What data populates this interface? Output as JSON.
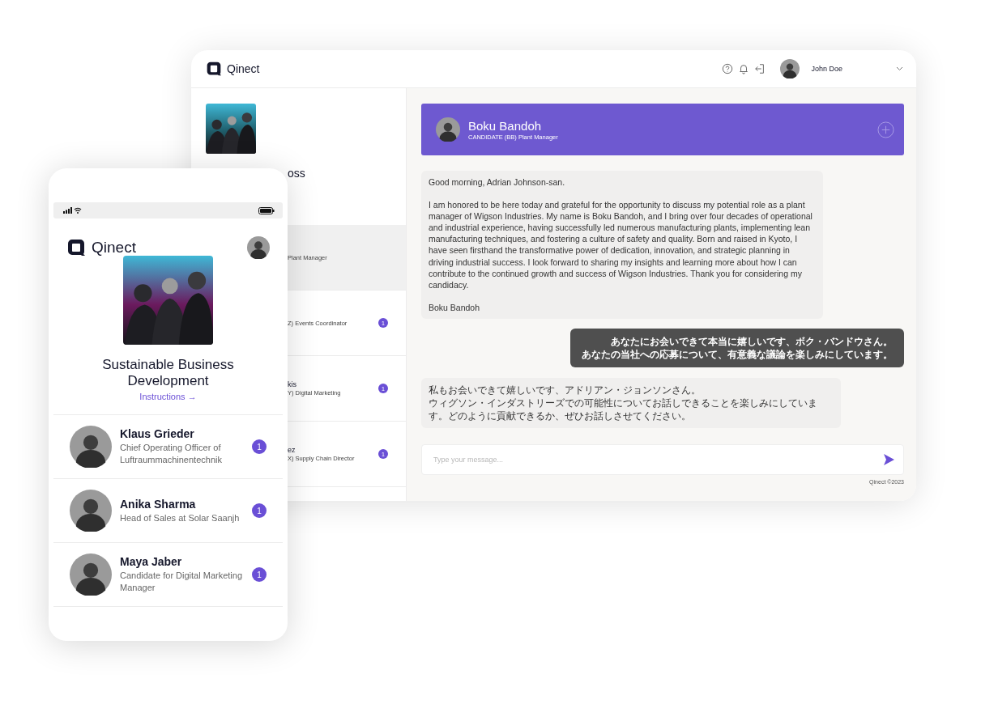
{
  "desktop": {
    "brand": "Qinect",
    "user": {
      "name": "John Doe"
    },
    "sidebar": {
      "course_title": "oss",
      "items": [
        {
          "role": "Plant Manager",
          "selected": true
        },
        {
          "role": "Z) Events Coordinator",
          "badge": "1",
          "selected": false
        },
        {
          "name": "kis",
          "role": "Y) Digital Marketing",
          "badge": "1",
          "selected": false
        },
        {
          "name": "ez",
          "role": "X) Supply Chain Director",
          "badge": "1",
          "selected": false
        }
      ]
    },
    "chat": {
      "header": {
        "name": "Boku Bandoh",
        "subtitle": "CANDIDATE (BB) Plant Manager"
      },
      "messages": [
        {
          "kind": "received",
          "lines": [
            "Good morning, Adrian Johnson-san.",
            "I am honored to be here today and grateful for the opportunity to discuss my potential role as a plant manager of Wigson Industries. My name is Boku Bandoh, and I bring over four decades of operational and industrial experience, having successfully led numerous manufacturing plants, implementing lean manufacturing techniques, and fostering a culture of safety and quality. Born and raised in Kyoto, I have seen firsthand the transformative power of dedication, innovation, and strategic planning in driving industrial success. I look forward to sharing my insights and learning more about how I can contribute to the continued growth and success of Wigson Industries. Thank you for considering my candidacy.",
            "Boku Bandoh"
          ]
        },
        {
          "kind": "sent",
          "lines": [
            "あなたにお会いできて本当に嬉しいです、ボク・バンドウさん。",
            "あなたの当社への応募について、有意義な議論を楽しみにしています。"
          ]
        },
        {
          "kind": "received",
          "lines": [
            "私もお会いできて嬉しいです、アドリアン・ジョンソンさん。",
            "ウィグソン・インダストリーズでの可能性についてお話しできることを楽しみにしています。どのように貢献できるか、ぜひお話しさせてください。"
          ]
        }
      ],
      "input": {
        "placeholder": "Type your message..."
      },
      "footer": "Qinect ©2023"
    }
  },
  "phone": {
    "brand": "Qinect",
    "course_title": "Sustainable Business Development",
    "link": "Instructions →",
    "contacts": [
      {
        "name": "Klaus Grieder",
        "role": "Chief Operating Officer of Luftraummachinentechnik",
        "badge": "1"
      },
      {
        "name": "Anika Sharma",
        "role": "Head of Sales at Solar Saanjh",
        "badge": "1"
      },
      {
        "name": "Maya Jaber",
        "role": "Candidate for Digital Marketing Manager",
        "badge": "1"
      }
    ]
  }
}
